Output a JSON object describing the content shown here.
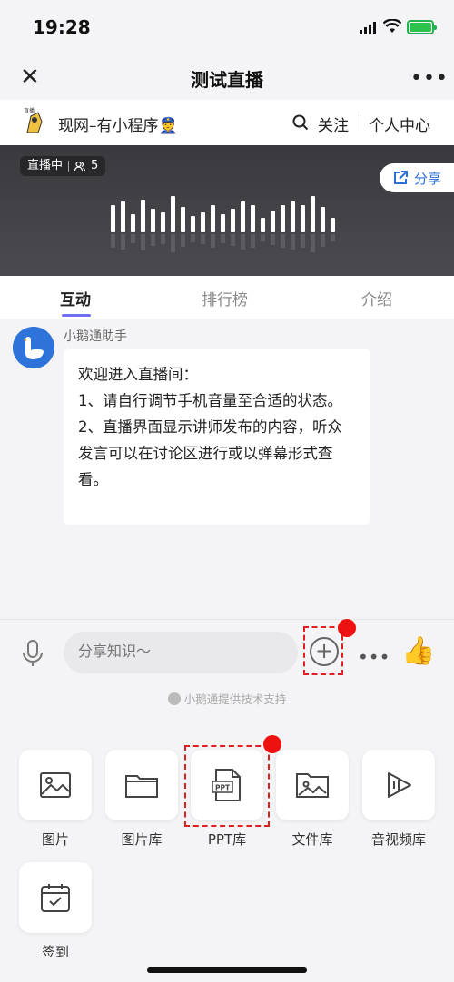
{
  "status_bar": {
    "time": "19:28"
  },
  "header": {
    "title": "测试直播"
  },
  "channel": {
    "name": "现网–有小程序👮",
    "follow_label": "关注",
    "personal_center_label": "个人中心"
  },
  "live": {
    "status_label": "直播中",
    "viewer_count": "5",
    "share_label": "分享"
  },
  "tabs": [
    {
      "label": "互动",
      "active": true
    },
    {
      "label": "排行榜",
      "active": false
    },
    {
      "label": "介绍",
      "active": false
    }
  ],
  "chat": {
    "sender": "小鹅通助手",
    "message_lines": [
      "欢迎进入直播间：",
      "1、请自行调节手机音量至合适的状态。",
      "2、直播界面显示讲师发布的内容，听众发言可以在讨论区进行或以弹幕形式查看。"
    ]
  },
  "input": {
    "placeholder": "分享知识～"
  },
  "powered_by": "小鹅通提供技术支持",
  "tools": [
    {
      "label": "图片",
      "icon": "image-icon"
    },
    {
      "label": "图片库",
      "icon": "folder-icon"
    },
    {
      "label": "PPT库",
      "icon": "ppt-file-icon"
    },
    {
      "label": "文件库",
      "icon": "image-folder-icon"
    },
    {
      "label": "音视频库",
      "icon": "play-icon"
    },
    {
      "label": "签到",
      "icon": "calendar-check-icon"
    }
  ],
  "colors": {
    "accent": "#6e6ef0",
    "share_blue": "#2e6fd8",
    "highlight_red": "#e02020",
    "avatar_blue": "#2e73d9"
  }
}
